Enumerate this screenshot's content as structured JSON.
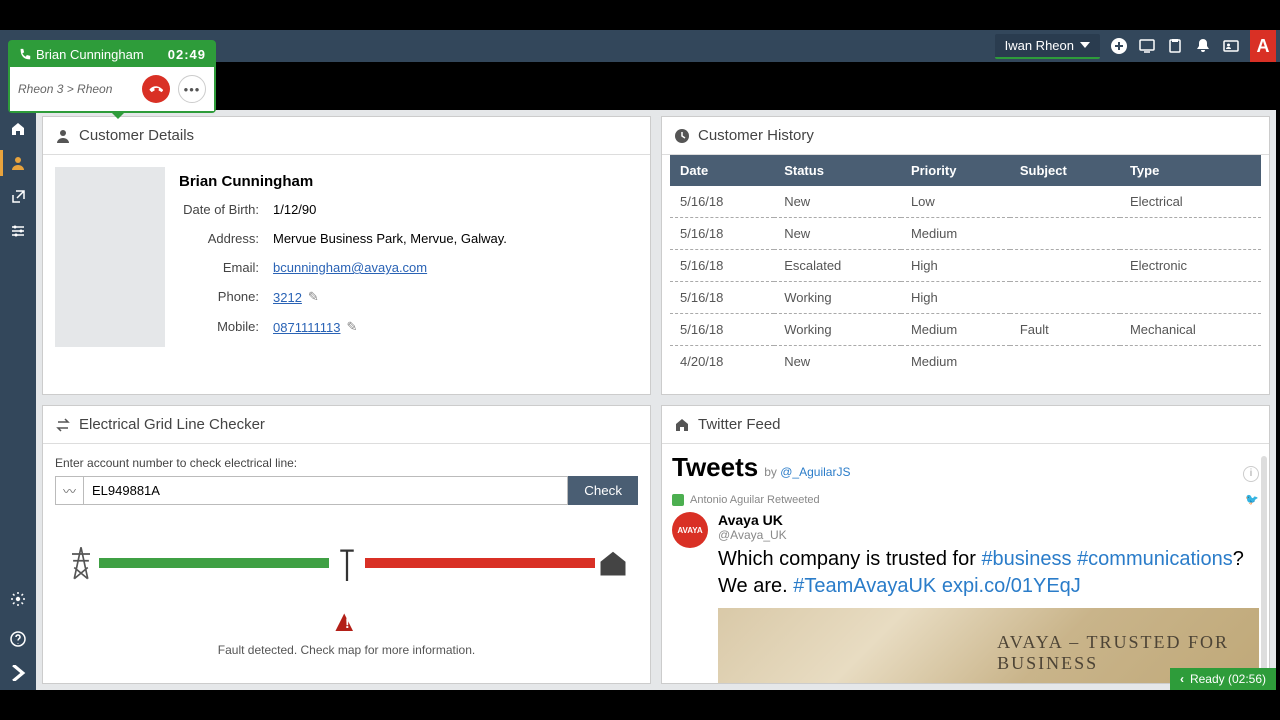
{
  "topbar": {
    "user": "Iwan Rheon",
    "brand_letter": "A"
  },
  "call": {
    "name": "Brian Cunningham",
    "timer": "02:49",
    "path": "Rheon 3 > Rheon"
  },
  "customer_details": {
    "title": "Customer Details",
    "name": "Brian Cunningham",
    "labels": {
      "dob": "Date of Birth:",
      "address": "Address:",
      "email": "Email:",
      "phone": "Phone:",
      "mobile": "Mobile:"
    },
    "dob": "1/12/90",
    "address": "Mervue Business Park, Mervue, Galway.",
    "email": "bcunningham@avaya.com",
    "phone": "3212",
    "mobile": "0871111113"
  },
  "customer_history": {
    "title": "Customer History",
    "columns": [
      "Date",
      "Status",
      "Priority",
      "Subject",
      "Type"
    ],
    "rows": [
      {
        "date": "5/16/18",
        "status": "New",
        "priority": "Low",
        "subject": "",
        "type": "Electrical"
      },
      {
        "date": "5/16/18",
        "status": "New",
        "priority": "Medium",
        "subject": "",
        "type": ""
      },
      {
        "date": "5/16/18",
        "status": "Escalated",
        "priority": "High",
        "subject": "",
        "type": "Electronic"
      },
      {
        "date": "5/16/18",
        "status": "Working",
        "priority": "High",
        "subject": "",
        "type": ""
      },
      {
        "date": "5/16/18",
        "status": "Working",
        "priority": "Medium",
        "subject": "Fault",
        "type": "Mechanical"
      },
      {
        "date": "4/20/18",
        "status": "New",
        "priority": "Medium",
        "subject": "",
        "type": ""
      }
    ]
  },
  "grid_checker": {
    "title": "Electrical Grid Line Checker",
    "hint": "Enter account number to check electrical line:",
    "value": "EL949881A",
    "check_label": "Check",
    "warn_msg": "Fault detected. Check map for more information."
  },
  "twitter": {
    "title": "Twitter Feed",
    "tweets_label": "Tweets",
    "by_label": "by ",
    "by_handle": "@_AguilarJS",
    "retweet_line": "Antonio Aguilar Retweeted",
    "post": {
      "user": "Avaya UK",
      "handle": "@Avaya_UK",
      "avatar_text": "AVAYA",
      "text_pre": "Which company is trusted for ",
      "hash1": "#business",
      "hash2": "#communications",
      "text_mid": "? We are. ",
      "hash3": "#TeamAvayaUK",
      "link": "expi.co/01YEqJ",
      "img_line1": "AVAYA – TRUSTED FOR",
      "img_line2": "BUSINESS"
    }
  },
  "status": {
    "label": "Ready (02:56)"
  }
}
